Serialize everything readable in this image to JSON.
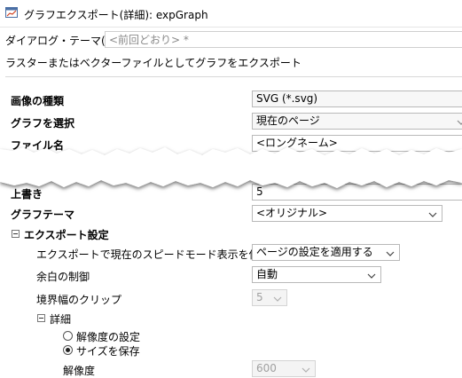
{
  "window": {
    "title": "グラフエクスポート(詳細): expGraph"
  },
  "dialog_theme": {
    "label": "ダイアログ・テーマ(H)",
    "value": "<前回どおり> *"
  },
  "description": "ラスターまたはベクターファイルとしてグラフをエクスポート",
  "rows": {
    "image_type": {
      "label": "画像の種類",
      "value": "SVG (*.svg)"
    },
    "select_graph": {
      "label": "グラフを選択",
      "value": "現在のページ"
    },
    "file_name": {
      "label": "ファイル名",
      "value": "<ロングネーム>"
    },
    "overwrite": {
      "label": "上書き",
      "value": "5"
    },
    "graph_theme": {
      "label": "グラフテーマ",
      "value": "<オリジナル>"
    }
  },
  "export_settings": {
    "label": "エクスポート設定",
    "speed_mode": {
      "label": "エクスポートで現在のスピードモード表示を使う",
      "value": "ページの設定を適用する"
    },
    "margin": {
      "label": "余白の制御",
      "value": "自動"
    },
    "clip": {
      "label": "境界幅のクリップ",
      "value": "5"
    },
    "details": {
      "label": "詳細",
      "radio_resolution": "解像度の設定",
      "radio_keep_size": "サイズを保存",
      "resolution": {
        "label": "解像度",
        "value": "600"
      }
    }
  },
  "icons": {
    "app": "graph-window-icon",
    "dropdown": "chevron-down-icon"
  }
}
